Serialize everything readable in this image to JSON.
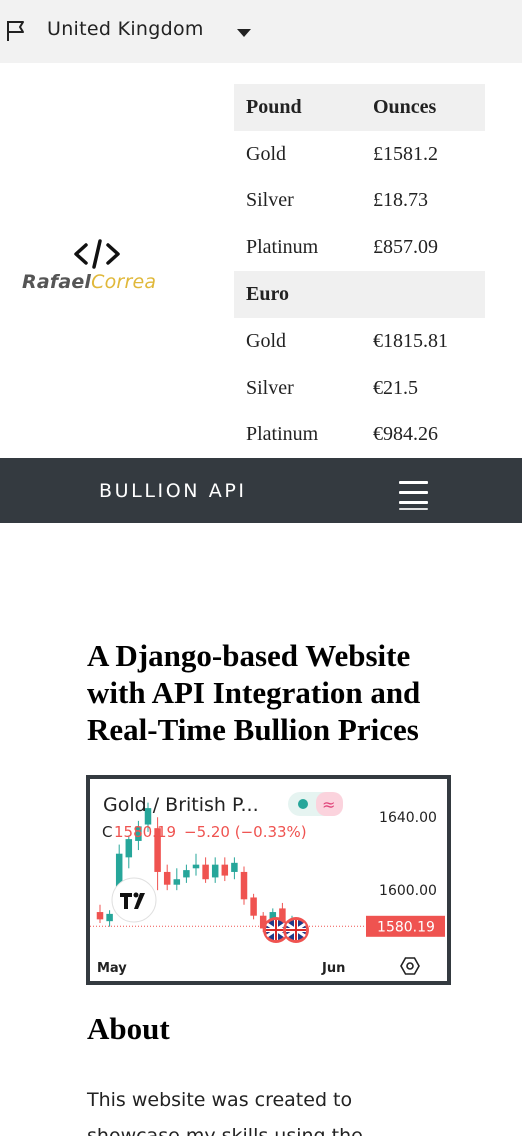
{
  "topbar": {
    "country": "United Kingdom",
    "flag_icon": "flag-icon",
    "caret_icon": "caret-down-icon"
  },
  "logo": {
    "symbol": "</>",
    "first": "Rafael",
    "last": "Correa",
    "colors": {
      "first": "#555555",
      "last": "#e0b83a"
    }
  },
  "price_table": {
    "sections": [
      {
        "currency": "Pound",
        "unit": "Ounces",
        "rows": [
          {
            "metal": "Gold",
            "price": "£1581.2"
          },
          {
            "metal": "Silver",
            "price": "£18.73"
          },
          {
            "metal": "Platinum",
            "price": "£857.09"
          }
        ]
      },
      {
        "currency": "Euro",
        "unit": "",
        "rows": [
          {
            "metal": "Gold",
            "price": "€1815.81"
          },
          {
            "metal": "Silver",
            "price": "€21.5"
          },
          {
            "metal": "Platinum",
            "price": "€984.26"
          }
        ]
      }
    ]
  },
  "navbar": {
    "brand": "BULLION API",
    "menu_icon": "hamburger-menu-icon",
    "color": "#343a40"
  },
  "heading": "A Django-based Website with API Integration and Real-Time Bullion Prices",
  "widget": {
    "symbol": "Gold / British P...",
    "close_prefix": "C",
    "close": "1580.19",
    "change": "−5.20 (−0.33%)",
    "current_price_label": "1580.19",
    "tv_logo": "TV",
    "settings_icon": "settings-hexagon-icon",
    "colors": {
      "up": "#26a69a",
      "down": "#ef5350"
    }
  },
  "chart_data": {
    "type": "candlestick",
    "x_ticks": [
      "May",
      "Jun"
    ],
    "y_ticks": [
      1600.0,
      1640.0
    ],
    "ylim": [
      1565,
      1650
    ],
    "current_price": 1580.19,
    "grid": false,
    "candles": [
      {
        "o": 1588,
        "h": 1592,
        "l": 1582,
        "c": 1584
      },
      {
        "o": 1583,
        "h": 1589,
        "l": 1580,
        "c": 1587
      },
      {
        "o": 1590,
        "h": 1625,
        "l": 1588,
        "c": 1620
      },
      {
        "o": 1618,
        "h": 1630,
        "l": 1612,
        "c": 1628
      },
      {
        "o": 1627,
        "h": 1638,
        "l": 1622,
        "c": 1635
      },
      {
        "o": 1636,
        "h": 1648,
        "l": 1632,
        "c": 1645
      },
      {
        "o": 1634,
        "h": 1640,
        "l": 1600,
        "c": 1610
      },
      {
        "o": 1610,
        "h": 1614,
        "l": 1600,
        "c": 1603
      },
      {
        "o": 1603,
        "h": 1612,
        "l": 1600,
        "c": 1606
      },
      {
        "o": 1607,
        "h": 1614,
        "l": 1604,
        "c": 1611
      },
      {
        "o": 1612,
        "h": 1620,
        "l": 1608,
        "c": 1614
      },
      {
        "o": 1614,
        "h": 1618,
        "l": 1604,
        "c": 1606
      },
      {
        "o": 1607,
        "h": 1618,
        "l": 1604,
        "c": 1614
      },
      {
        "o": 1614,
        "h": 1618,
        "l": 1605,
        "c": 1608
      },
      {
        "o": 1610,
        "h": 1618,
        "l": 1606,
        "c": 1615
      },
      {
        "o": 1610,
        "h": 1613,
        "l": 1592,
        "c": 1595
      },
      {
        "o": 1596,
        "h": 1598,
        "l": 1584,
        "c": 1586
      },
      {
        "o": 1586,
        "h": 1588,
        "l": 1577,
        "c": 1579
      },
      {
        "o": 1577,
        "h": 1590,
        "l": 1575,
        "c": 1588
      },
      {
        "o": 1590,
        "h": 1593,
        "l": 1580,
        "c": 1582
      },
      {
        "o": 1581,
        "h": 1586,
        "l": 1578,
        "c": 1583
      }
    ]
  },
  "about": {
    "title": "About",
    "text": "This website was created to showcase my skills using the"
  }
}
